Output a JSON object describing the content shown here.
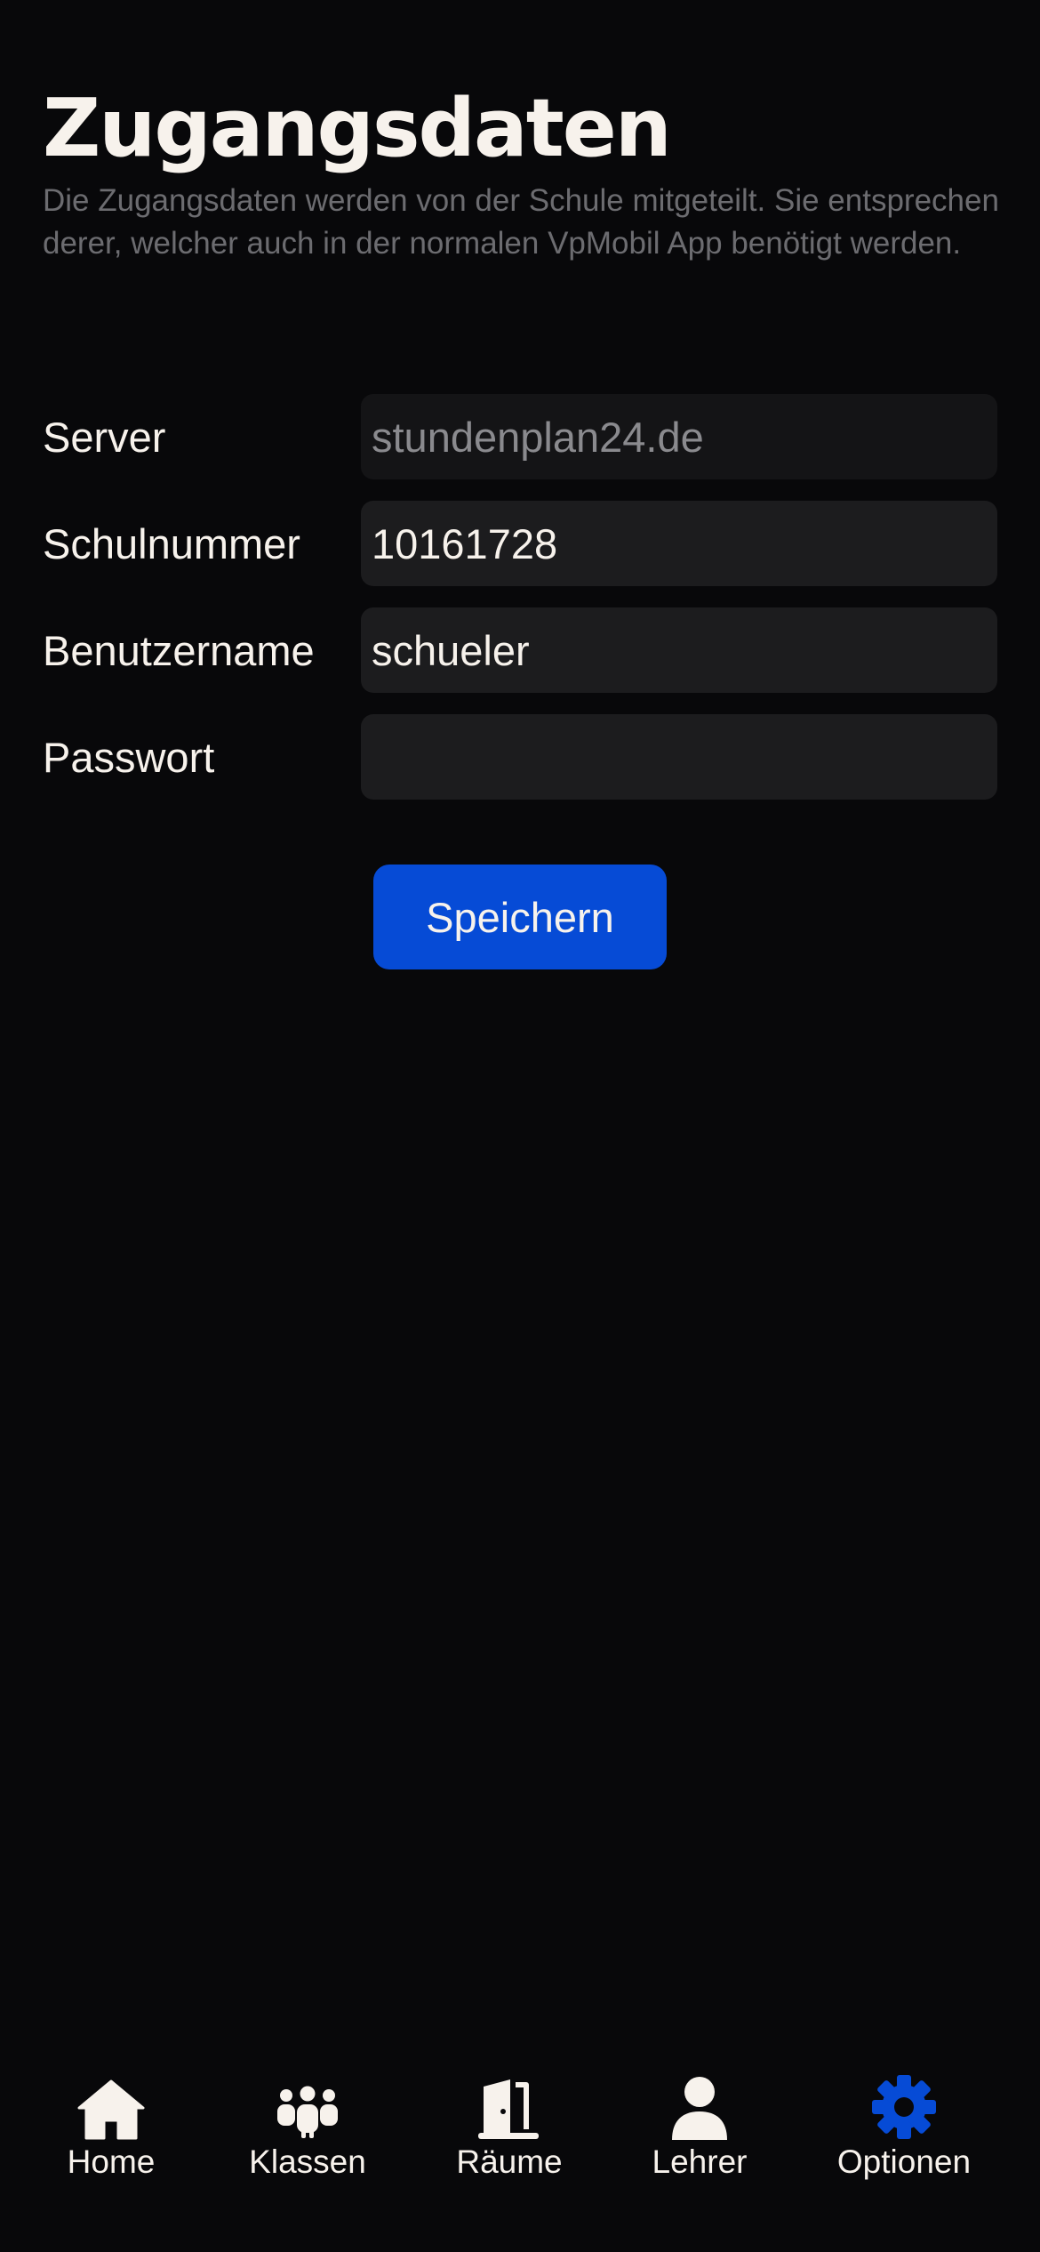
{
  "header": {
    "title": "Zugangsdaten",
    "subtitle": "Die Zugangsdaten werden von der Schule mitgeteilt. Sie entsprechen derer, welcher auch in der normalen VpMobil App benötigt werden."
  },
  "form": {
    "server": {
      "label": "Server",
      "placeholder": "stundenplan24.de",
      "value": ""
    },
    "school_number": {
      "label": "Schulnummer",
      "value": "10161728"
    },
    "username": {
      "label": "Benutzername",
      "value": "schueler"
    },
    "password": {
      "label": "Passwort",
      "value": ""
    },
    "save_label": "Speichern"
  },
  "tabs": [
    {
      "label": "Home",
      "icon": "home-icon",
      "active": false
    },
    {
      "label": "Klassen",
      "icon": "group-icon",
      "active": false
    },
    {
      "label": "Räume",
      "icon": "door-icon",
      "active": false
    },
    {
      "label": "Lehrer",
      "icon": "person-icon",
      "active": false
    },
    {
      "label": "Optionen",
      "icon": "gear-icon",
      "active": true
    }
  ],
  "colors": {
    "background": "#08080a",
    "accent": "#064bd6",
    "text": "#f7f2ec",
    "muted": "#6c6c70",
    "input_bg": "#1c1c1e"
  }
}
